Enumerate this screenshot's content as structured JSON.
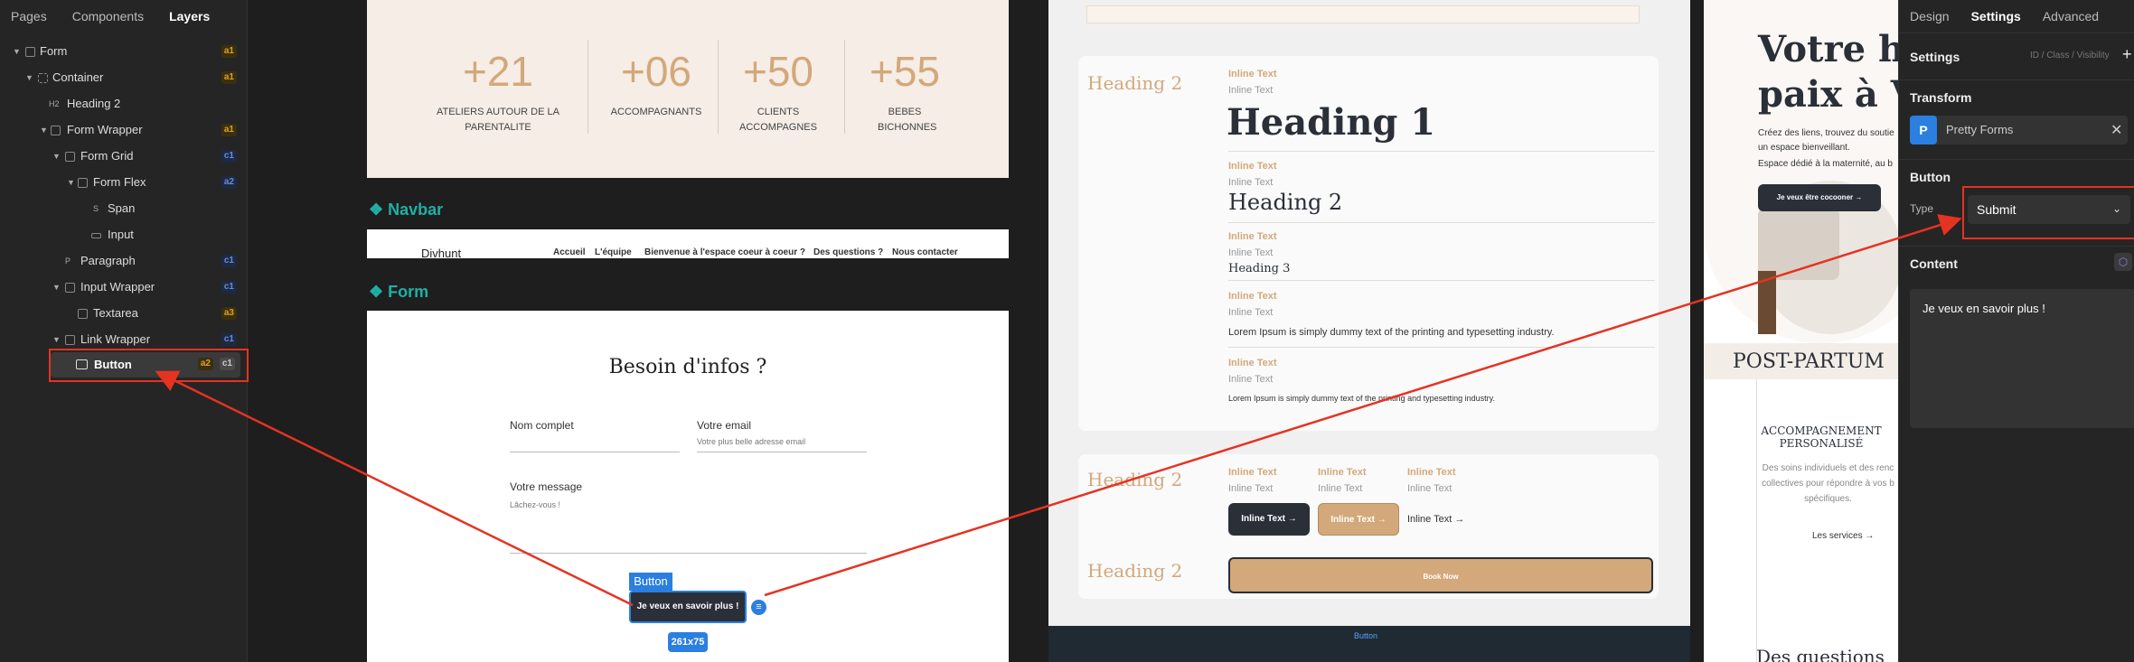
{
  "left_panel": {
    "tabs": [
      "Pages",
      "Components",
      "Layers"
    ],
    "layers": [
      {
        "label": "Form",
        "badges": [
          "a1"
        ]
      },
      {
        "label": "Container",
        "badges": [
          "a1"
        ]
      },
      {
        "label": "Heading 2",
        "badges": []
      },
      {
        "label": "Form Wrapper",
        "badges": [
          "a1"
        ]
      },
      {
        "label": "Form Grid",
        "badges": [
          "c1"
        ]
      },
      {
        "label": "Form Flex",
        "badges": [
          "a2"
        ]
      },
      {
        "label": "Span",
        "badges": []
      },
      {
        "label": "Input",
        "badges": []
      },
      {
        "label": "Paragraph",
        "badges": [
          "c1"
        ]
      },
      {
        "label": "Input Wrapper",
        "badges": [
          "c1"
        ]
      },
      {
        "label": "Textarea",
        "badges": [
          "a3"
        ]
      },
      {
        "label": "Link Wrapper",
        "badges": [
          "c1"
        ]
      },
      {
        "label": "Button",
        "badges": [
          "a2",
          "c1"
        ]
      }
    ],
    "icon_labels": {
      "heading": "H2",
      "span": "S",
      "paragraph": "P"
    }
  },
  "stats": [
    {
      "number": "+21",
      "label": "ATELIERS AUTOUR DE LA PARENTALITE"
    },
    {
      "number": "+06",
      "label": "ACCOMPAGNANTS"
    },
    {
      "number": "+50",
      "label": "CLIENTS ACCOMPAGNES"
    },
    {
      "number": "+55",
      "label": "BEBES BICHONNES"
    }
  ],
  "sections": {
    "navbar": "❖ Navbar",
    "form": "❖ Form"
  },
  "navbar": {
    "logo": "Divhunt",
    "links": [
      "Accueil",
      "L'équipe",
      "Bienvenue à l'espace coeur à coeur ?",
      "Des questions ?",
      "Nous contacter"
    ]
  },
  "form": {
    "title": "Besoin d'infos ?",
    "name_label": "Nom complet",
    "email_label": "Votre email",
    "email_placeholder": "Votre plus belle adresse email",
    "message_label": "Votre message",
    "message_placeholder": "Lâchez-vous !",
    "button_text": "Je veux en savoir plus !",
    "selection_tag": "Button",
    "size_tag": "261x75"
  },
  "styles": {
    "heading2": "Heading 2",
    "inline_text": "Inline Text",
    "heading1": "Heading 1",
    "heading3": "Heading 3",
    "lorem": "Lorem Ipsum is simply dummy text of the printing and typesetting industry.",
    "book_now": "Book Now",
    "bottom_tag": "Button"
  },
  "preview": {
    "title": "Votre ha\npaix à Vo",
    "text1": "Créez des liens, trouvez du soutie",
    "text2": "un espace bienveillant.",
    "text3": "Espace dédié à la maternité, au b",
    "cta": "Je veux être cocooner →",
    "postpartum": "POST-PARTUM",
    "acc_title": "ACCOMPAGNEMENT PERSONALISÉ",
    "acc_text": "Des soins individuels et des renc collectives pour répondre à vos b spécifiques.",
    "services": "Les services →",
    "questions": "Des questions"
  },
  "right_panel": {
    "tabs": [
      "Design",
      "Settings",
      "Advanced"
    ],
    "settings_title": "Settings",
    "settings_hint": "ID / Class / Visibility",
    "transform_title": "Transform",
    "transform_item": "Pretty Forms",
    "button_title": "Button",
    "type_label": "Type",
    "type_value": "Submit",
    "content_title": "Content",
    "content_value": "Je veux en savoir plus !"
  },
  "colors": {
    "accent": "#d3a87a",
    "teal": "#1fb0a6",
    "red": "#e53322",
    "blue": "#2a7fe0",
    "dark": "#2a2f38"
  }
}
